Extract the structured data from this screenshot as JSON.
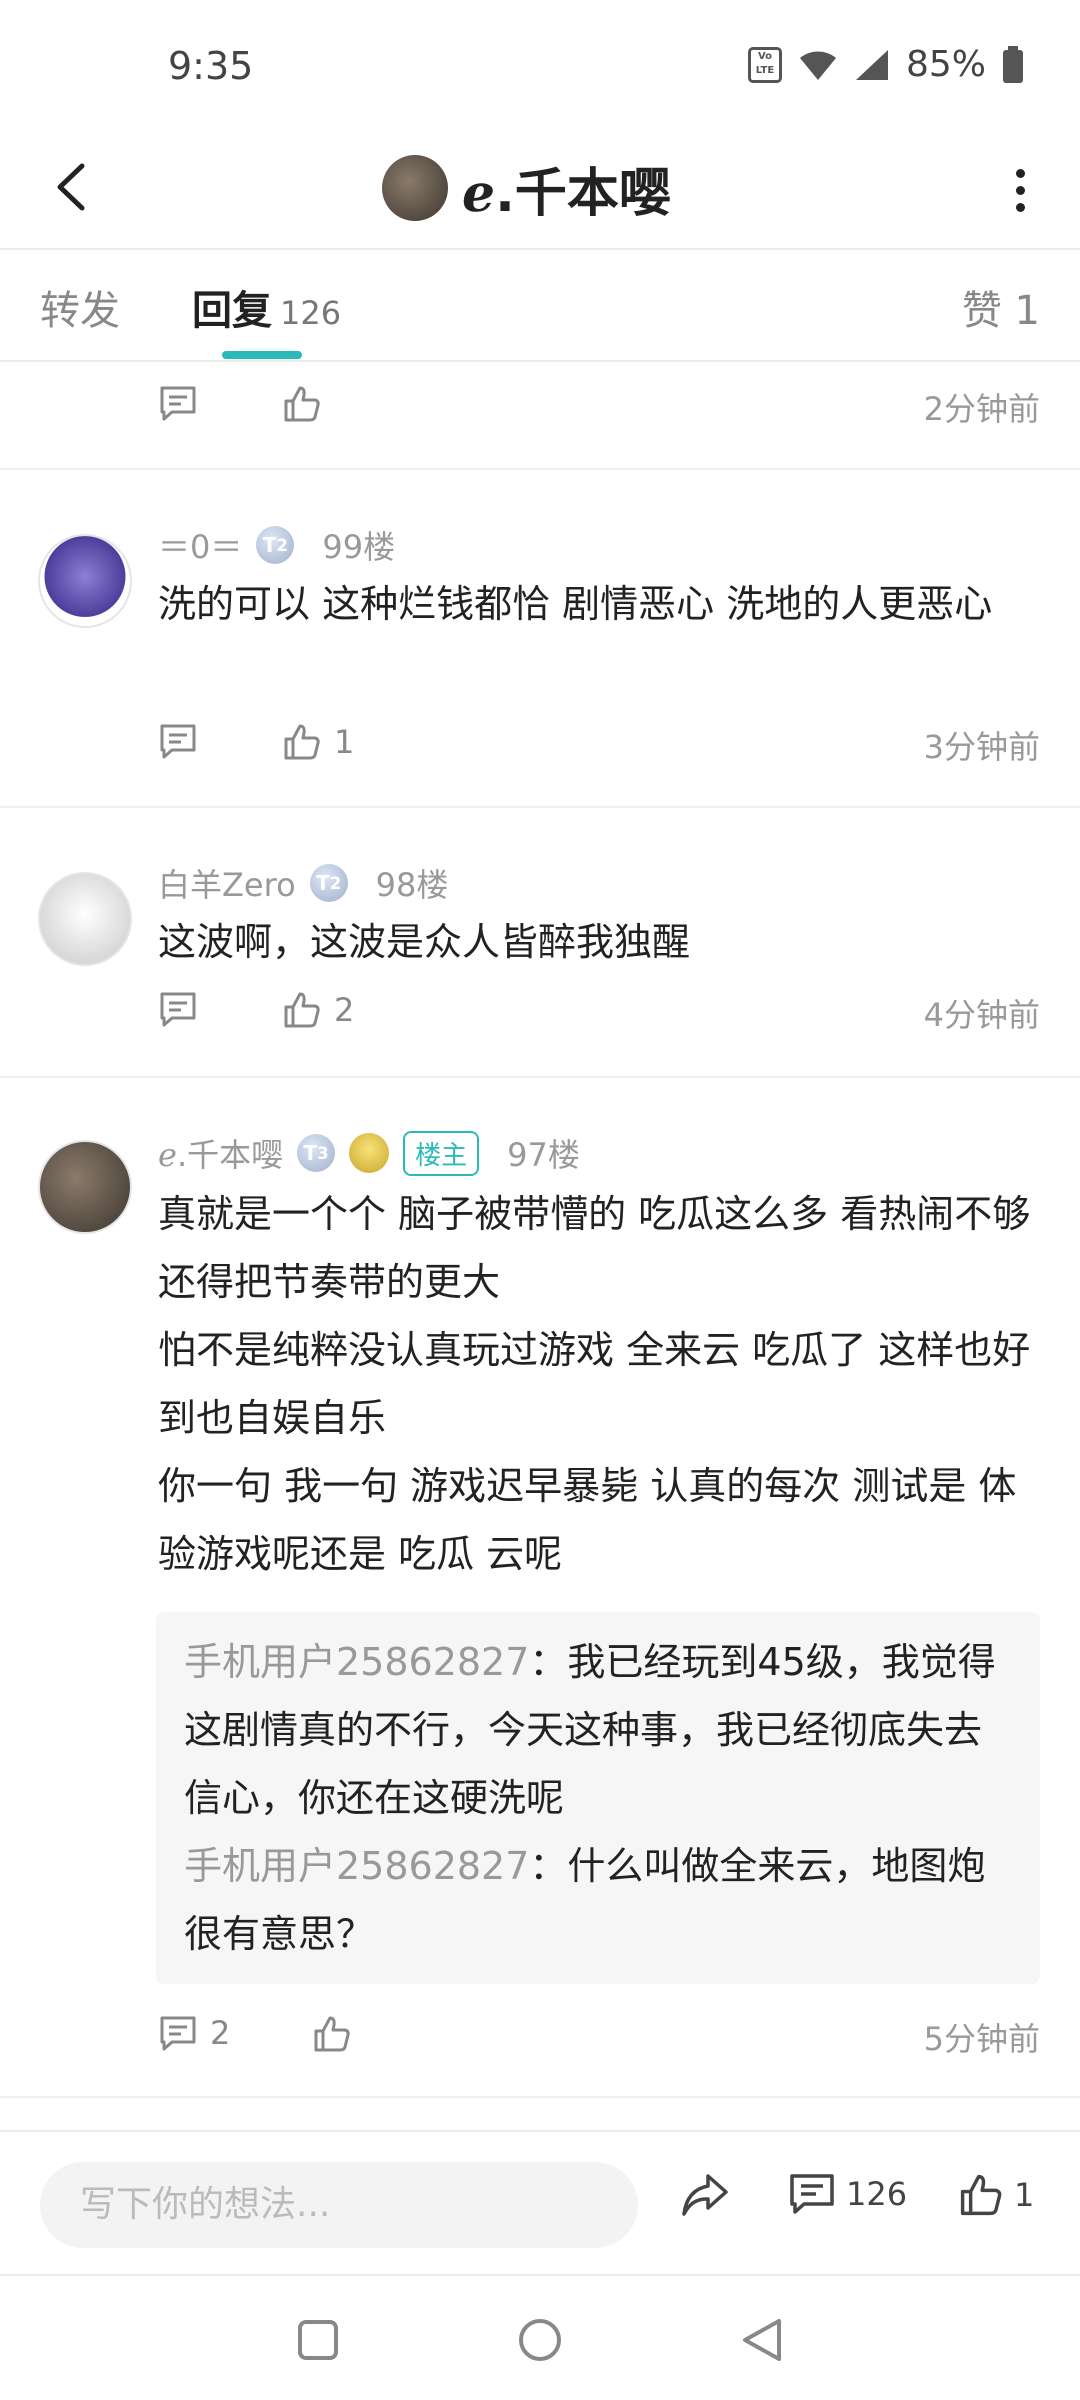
{
  "status_bar": {
    "time": "9:35",
    "battery": "85%",
    "volte": "Vo LTE"
  },
  "header": {
    "title": "ℯ.千本嘤"
  },
  "tabs": {
    "forward": "转发",
    "reply": "回复",
    "reply_count": "126",
    "likes": "赞 1"
  },
  "comments": [
    {
      "time": "2分钟前",
      "like_count": "",
      "reply_count": ""
    },
    {
      "username": "＝0＝",
      "level": "2",
      "floor": "99楼",
      "text": "洗的可以  这种烂钱都恰  剧情恶心  洗地的人更恶心",
      "like_count": "1",
      "time": "3分钟前"
    },
    {
      "username": "白羊Zero",
      "level": "2",
      "floor": "98楼",
      "text": "这波啊，这波是众人皆醉我独醒",
      "like_count": "2",
      "time": "4分钟前"
    },
    {
      "username": "ℯ.千本嘤",
      "level": "3",
      "owner_badge": "楼主",
      "floor": "97楼",
      "text_lines": [
        "真就是一个个   脑子被带懵的  吃瓜这么多  看热闹不够还得把节奏带的更大",
        "怕不是纯粹没认真玩过游戏   全来云  吃瓜了  这样也好到也自娱自乐",
        "你一句  我一句  游戏迟早暴毙   认真的每次  测试是 体验游戏呢还是  吃瓜  云呢"
      ],
      "quotes": [
        {
          "name": "手机用户25862827",
          "text": "：我已经玩到45级，我觉得这剧情真的不行，今天这种事，我已经彻底失去信心，你还在这硬洗呢"
        },
        {
          "name": "手机用户25862827",
          "text": "：什么叫做全来云，地图炮很有意思？"
        }
      ],
      "reply_count": "2",
      "time": "5分钟前"
    }
  ],
  "bottom_bar": {
    "input_placeholder": "写下你的想法...",
    "comment_count": "126",
    "like_count": "1"
  },
  "colors": {
    "accent": "#2cbab8"
  }
}
